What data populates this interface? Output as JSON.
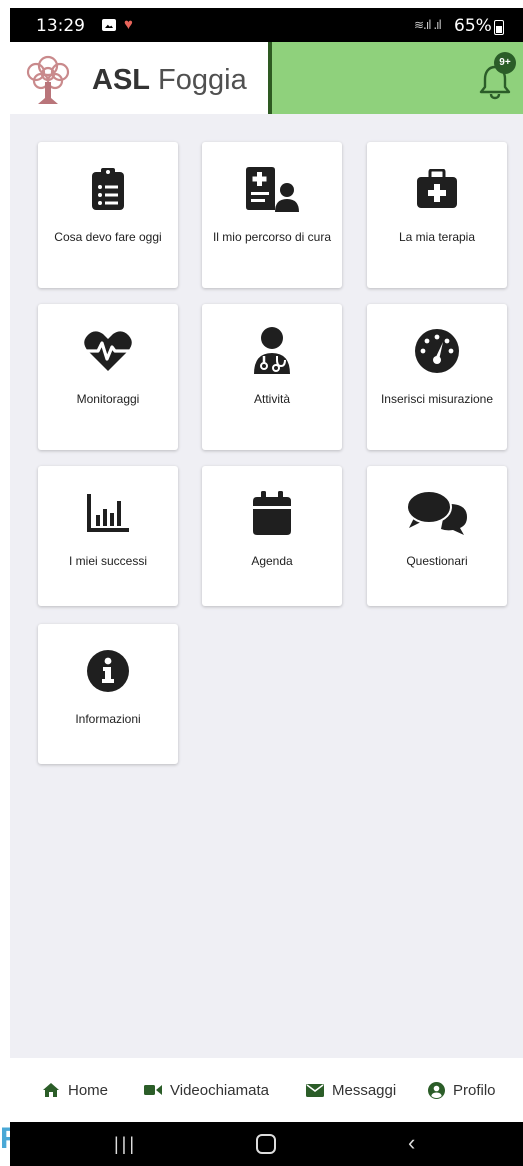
{
  "status": {
    "time": "13:29",
    "battery": "65%"
  },
  "header": {
    "brand_bold": "ASL",
    "brand_rest": " Foggia",
    "badge": "9+"
  },
  "tiles": [
    {
      "label": "Cosa devo fare oggi",
      "icon": "clipboard-list-icon"
    },
    {
      "label": "Il mio percorso di cura",
      "icon": "medical-record-user-icon"
    },
    {
      "label": "La mia terapia",
      "icon": "first-aid-kit-icon"
    },
    {
      "label": "Monitoraggi",
      "icon": "heartbeat-icon"
    },
    {
      "label": "Attività",
      "icon": "doctor-icon"
    },
    {
      "label": "Inserisci misurazione",
      "icon": "gauge-icon"
    },
    {
      "label": "I miei successi",
      "icon": "bar-chart-icon"
    },
    {
      "label": "Agenda",
      "icon": "calendar-icon"
    },
    {
      "label": "Questionari",
      "icon": "chat-bubbles-icon"
    },
    {
      "label": "Informazioni",
      "icon": "info-circle-icon"
    }
  ],
  "bottom_nav": {
    "home": "Home",
    "video": "Videochiamata",
    "messages": "Messaggi",
    "profile": "Profilo"
  },
  "colors": {
    "accent_green": "#8fd17c",
    "dark_green": "#2b5d28",
    "icon": "#1f1f1f"
  }
}
